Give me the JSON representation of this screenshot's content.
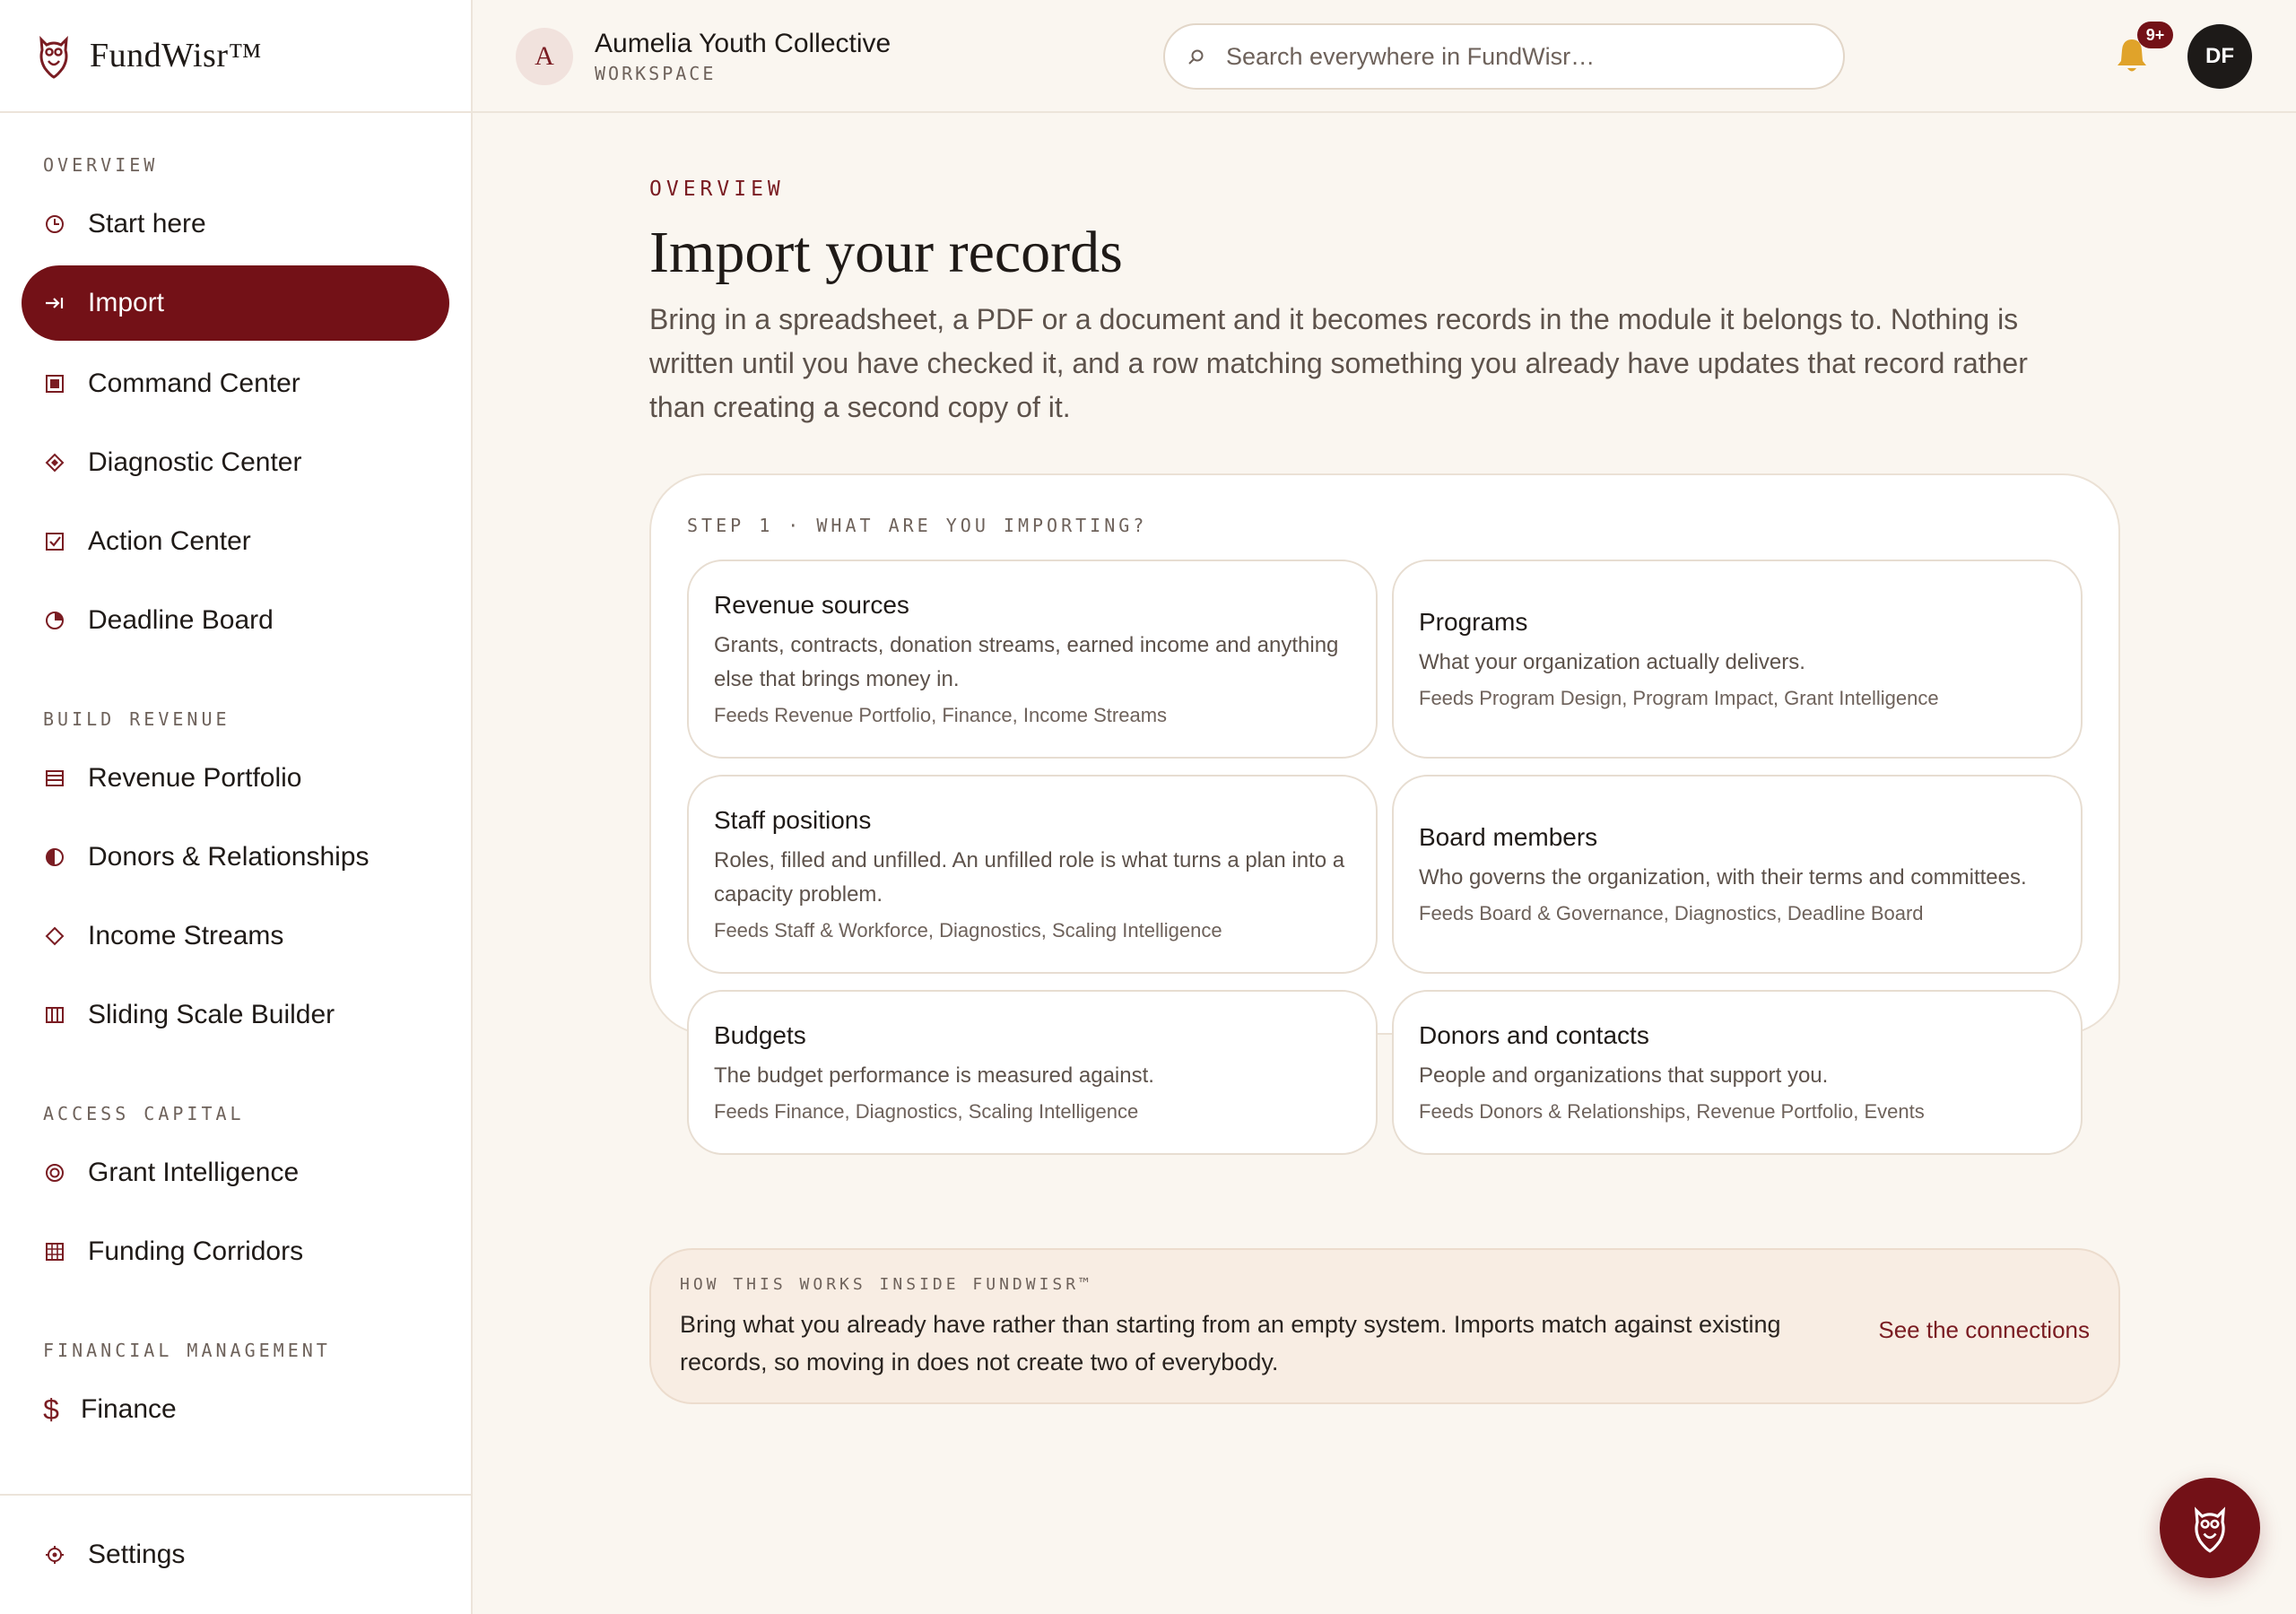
{
  "brand": {
    "name": "FundWisr™"
  },
  "sidebar": {
    "sections": [
      {
        "label": "OVERVIEW",
        "items": [
          {
            "label": "Start here",
            "icon": "clock-icon"
          },
          {
            "label": "Import",
            "icon": "import-arrow-icon",
            "active": true
          },
          {
            "label": "Command Center",
            "icon": "square-icon"
          },
          {
            "label": "Diagnostic Center",
            "icon": "diamond-icon"
          },
          {
            "label": "Action Center",
            "icon": "checkbox-icon"
          },
          {
            "label": "Deadline Board",
            "icon": "pie-icon"
          }
        ]
      },
      {
        "label": "BUILD REVENUE",
        "items": [
          {
            "label": "Revenue Portfolio",
            "icon": "list-icon"
          },
          {
            "label": "Donors & Relationships",
            "icon": "half-circle-icon"
          },
          {
            "label": "Income Streams",
            "icon": "diamond-outline-icon"
          },
          {
            "label": "Sliding Scale Builder",
            "icon": "columns-icon"
          }
        ]
      },
      {
        "label": "ACCESS CAPITAL",
        "items": [
          {
            "label": "Grant Intelligence",
            "icon": "target-icon"
          },
          {
            "label": "Funding Corridors",
            "icon": "grid-icon"
          }
        ]
      },
      {
        "label": "FINANCIAL MANAGEMENT",
        "items": [
          {
            "label": "Finance",
            "icon": "dollar-icon"
          }
        ]
      }
    ],
    "footer": {
      "label": "Settings",
      "icon": "gear-icon"
    }
  },
  "topbar": {
    "workspace_initial": "A",
    "workspace_name": "Aumelia Youth Collective",
    "workspace_sub": "WORKSPACE",
    "search_placeholder": "Search everywhere in FundWisr…",
    "notifications_badge": "9+",
    "user_initials": "DF"
  },
  "main": {
    "eyebrow": "OVERVIEW",
    "title": "Import your records",
    "description": "Bring in a spreadsheet, a PDF or a document and it becomes records in the module it belongs to. Nothing is written until you have checked it, and a row matching something you already have updates that record rather than creating a second copy of it.",
    "step_label": "STEP 1 · WHAT ARE YOU IMPORTING?",
    "options": [
      {
        "title": "Revenue sources",
        "desc": "Grants, contracts, donation streams, earned income and anything else that brings money in.",
        "feeds": "Feeds Revenue Portfolio, Finance, Income Streams"
      },
      {
        "title": "Programs",
        "desc": "What your organization actually delivers.",
        "feeds": "Feeds Program Design, Program Impact, Grant Intelligence"
      },
      {
        "title": "Staff positions",
        "desc": "Roles, filled and unfilled. An unfilled role is what turns a plan into a capacity problem.",
        "feeds": "Feeds Staff & Workforce, Diagnostics, Scaling Intelligence"
      },
      {
        "title": "Board members",
        "desc": "Who governs the organization, with their terms and committees.",
        "feeds": "Feeds Board & Governance, Diagnostics, Deadline Board"
      },
      {
        "title": "Budgets",
        "desc": "The budget performance is measured against.",
        "feeds": "Feeds Finance, Diagnostics, Scaling Intelligence"
      },
      {
        "title": "Donors and contacts",
        "desc": "People and organizations that support you.",
        "feeds": "Feeds Donors & Relationships, Revenue Portfolio, Events"
      }
    ],
    "info": {
      "label": "HOW THIS WORKS INSIDE FUNDWISR™",
      "text": "Bring what you already have rather than starting from an empty system. Imports match against existing records, so moving in does not create two of everybody.",
      "link": "See the connections"
    }
  },
  "colors": {
    "accent": "#731117",
    "background": "#faf6f0",
    "bell": "#e0a32a"
  }
}
